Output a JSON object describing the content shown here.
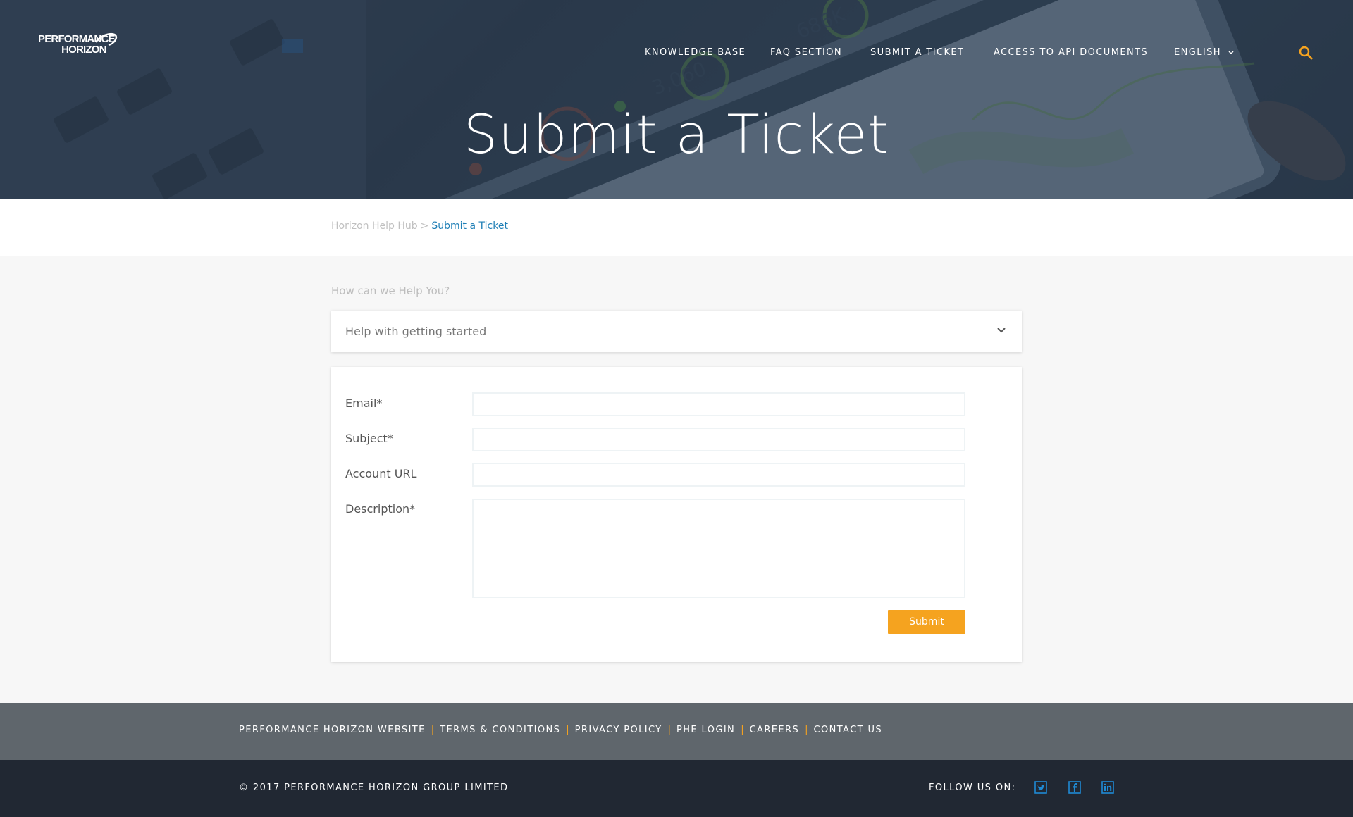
{
  "header": {
    "logo_line1": "PERFORMANCE",
    "logo_line2": "HORIZON",
    "nav": {
      "knowledge_base": "KNOWLEDGE BASE",
      "faq_section": "FAQ SECTION",
      "submit_ticket": "SUBMIT A TICKET",
      "api_docs": "ACCESS TO API DOCUMENTS",
      "language": "ENGLISH"
    },
    "search_icon": "search-icon",
    "hero_title": "Submit a Ticket"
  },
  "breadcrumb": {
    "home": "Horizon Help Hub",
    "separator": ">",
    "current": "Submit a Ticket"
  },
  "main": {
    "help_prompt": "How can we Help You?",
    "topic_select": {
      "selected": "Help with getting started"
    },
    "form": {
      "email_label": "Email*",
      "email_value": "",
      "subject_label": "Subject*",
      "subject_value": "",
      "account_url_label": "Account URL",
      "account_url_value": "",
      "description_label": "Description*",
      "description_value": "",
      "submit_label": "Submit"
    }
  },
  "footer": {
    "links": {
      "website": "PERFORMANCE HORIZON WEBSITE",
      "terms": "TERMS & CONDITIONS",
      "privacy": "PRIVACY POLICY",
      "phe_login": "PHE LOGIN",
      "careers": "CAREERS",
      "contact": "CONTACT US"
    },
    "separator": "|",
    "copyright": "© 2017 PERFORMANCE HORIZON GROUP LIMITED",
    "follow_label": "FOLLOW US ON:",
    "social_icons": [
      "twitter-icon",
      "facebook-icon",
      "linkedin-icon"
    ]
  },
  "colors": {
    "accent": "#f5a31f",
    "link": "#1f7fb6",
    "hero_overlay": "#263446",
    "footer_links_bg": "#5f666c",
    "footer_bottom_bg": "#212833",
    "social_blue": "#1f8ad4"
  }
}
